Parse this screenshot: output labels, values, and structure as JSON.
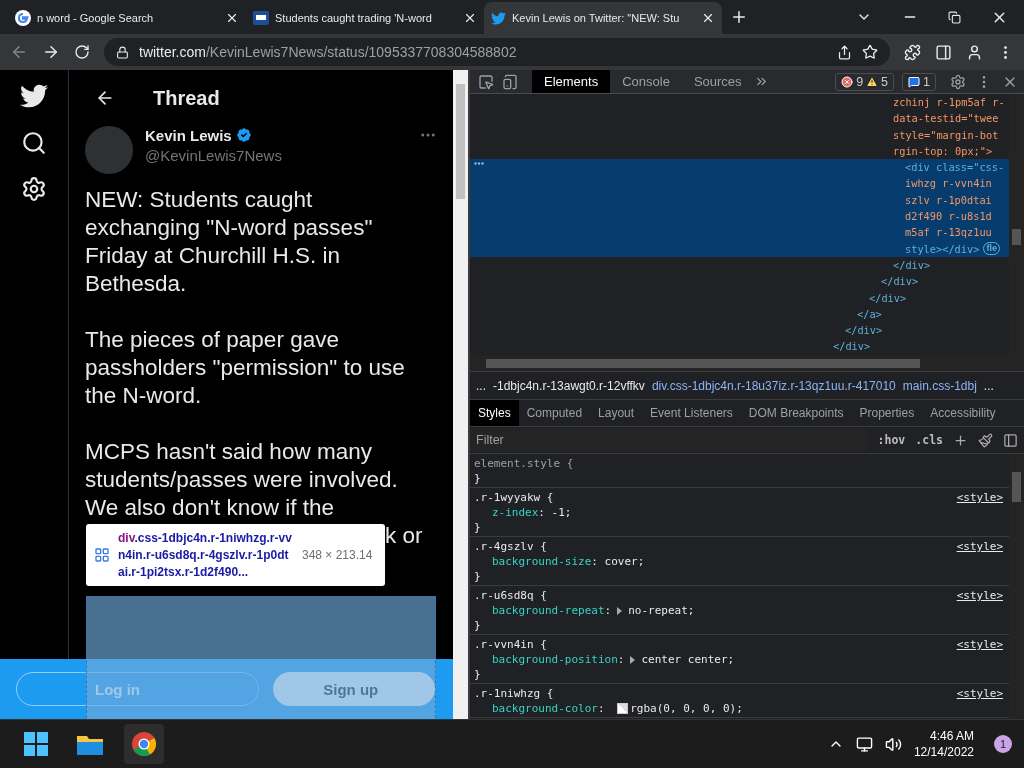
{
  "browser_tabs": [
    {
      "title": "n word - Google Search",
      "kind": "google",
      "selected": false
    },
    {
      "title": "Students caught trading 'N-word",
      "kind": "news",
      "selected": false
    },
    {
      "title": "Kevin Lewis on Twitter: \"NEW: Stu",
      "kind": "twitter",
      "selected": true
    }
  ],
  "address_bar": {
    "domain": "twitter.com",
    "path": "/KevinLewis7News/status/1095337708304588802"
  },
  "page": {
    "header": "Thread",
    "author": {
      "name": "Kevin Lewis",
      "verified": true,
      "handle": "@KevinLewis7News"
    },
    "tweet_paragraphs": [
      "NEW: Students caught exchanging \"N-word passes\" Friday at Churchill H.S. in Bethesda.",
      "The pieces of paper gave passholders \"permission\" to use the N-word.",
      "MCPS hasn't said how many students/passes were involved. We also don't know if the"
    ],
    "tweet_fragment": "k or",
    "buttons": [
      {
        "label": "Log in",
        "kind": "outline"
      },
      {
        "label": "Sign up",
        "kind": "filled"
      }
    ]
  },
  "inspect_tooltip": {
    "tag": "div",
    "classes": ".css-1dbjc4n.r-1niwhzg.r-vvn4in.r-u6sd8q.r-4gszlv.r-1p0dtai.r-1pi2tsx.r-1d2f490...",
    "size": "348 × 213.14"
  },
  "devtools": {
    "tabs": [
      {
        "label": "Elements",
        "selected": true
      },
      {
        "label": "Console",
        "selected": false
      },
      {
        "label": "Sources",
        "selected": false
      }
    ],
    "errors": "9",
    "warnings": "5",
    "messages": "1",
    "dom_tree": {
      "closing": "</div>",
      "children": [
        {
          "closing": "</div>",
          "children": [
            {
              "closing": "</a>",
              "children": [
                {
                  "closing": "</div>",
                  "children": [
                    {
                      "closing": "</div>",
                      "children": [
                        {
                          "lines": [
                            {
                              "text": "zchinj r-1pm5af r-",
                              "kind": "attr"
                            },
                            {
                              "text": "data-testid=\"twee",
                              "kind": "attr"
                            },
                            {
                              "text": "style=\"margin-bot",
                              "kind": "attr"
                            },
                            {
                              "text": "rgin-top: 0px;\">",
                              "kind": "attr"
                            }
                          ],
                          "closing": "</div>",
                          "children": [
                            {
                              "selected": true,
                              "badge": "fle",
                              "lines": [
                                {
                                  "text": "<div class=\"css-",
                                  "kind": "tag"
                                },
                                {
                                  "text": "iwhzg r-vvn4in",
                                  "kind": "attr"
                                },
                                {
                                  "text": "szlv r-1p0dtai",
                                  "kind": "attr"
                                },
                                {
                                  "text": "d2f490 r-u8s1d",
                                  "kind": "attr"
                                },
                                {
                                  "text": "m5af r-13qz1uu",
                                  "kind": "attr"
                                },
                                {
                                  "text": "style></div>",
                                  "kind": "tag"
                                }
                              ]
                            }
                          ]
                        }
                      ]
                    }
                  ]
                }
              ]
            }
          ]
        }
      ]
    },
    "breadcrumbs": [
      {
        "text": "...",
        "kind": "plain"
      },
      {
        "text": "-1dbjc4n.r-13awgt0.r-12vffkv",
        "kind": "plain"
      },
      {
        "text": "div.css-1dbjc4n.r-18u37iz.r-13qz1uu.r-417010",
        "kind": "link"
      },
      {
        "text": "main.css-1dbj",
        "kind": "link"
      },
      {
        "text": "...",
        "kind": "plain"
      }
    ],
    "panel_tabs": [
      {
        "label": "Styles",
        "selected": true
      },
      {
        "label": "Computed",
        "selected": false
      },
      {
        "label": "Layout",
        "selected": false
      },
      {
        "label": "Event Listeners",
        "selected": false
      },
      {
        "label": "DOM Breakpoints",
        "selected": false
      },
      {
        "label": "Properties",
        "selected": false
      },
      {
        "label": "Accessibility",
        "selected": false
      }
    ],
    "filter": {
      "placeholder": "Filter"
    },
    "filter_buttons": [
      ":hov",
      ".cls"
    ],
    "rules": [
      {
        "selector": "element.style {",
        "kind": "inline",
        "close": "}"
      },
      {
        "selector": ".r-1wyyakw {",
        "kind": "sheet",
        "source": "<style>",
        "close": "}",
        "props": [
          {
            "name": "z-index",
            "separator": ":",
            "value": "-1;",
            "kind": "plain"
          }
        ]
      },
      {
        "selector": ".r-4gszlv {",
        "kind": "sheet",
        "source": "<style>",
        "close": "}",
        "props": [
          {
            "name": "background-size",
            "separator": ":",
            "value": "cover;",
            "kind": "plain"
          }
        ]
      },
      {
        "selector": ".r-u6sd8q {",
        "kind": "sheet",
        "source": "<style>",
        "close": "}",
        "props": [
          {
            "name": "background-repeat",
            "separator": ":",
            "value": "no-repeat;",
            "kind": "expandable"
          }
        ]
      },
      {
        "selector": ".r-vvn4in {",
        "kind": "sheet",
        "source": "<style>",
        "close": "}",
        "props": [
          {
            "name": "background-position",
            "separator": ":",
            "value": "center center;",
            "kind": "expandable"
          }
        ]
      },
      {
        "selector": ".r-1niwhzg {",
        "kind": "sheet",
        "source": "<style>",
        "props": [
          {
            "name": "background-color",
            "separator": ":",
            "value": "rgba(0, 0, 0, 0);",
            "kind": "color"
          }
        ]
      }
    ]
  },
  "taskbar": {
    "time": "4:46 AM",
    "date": "12/14/2022",
    "notifications": "1"
  }
}
